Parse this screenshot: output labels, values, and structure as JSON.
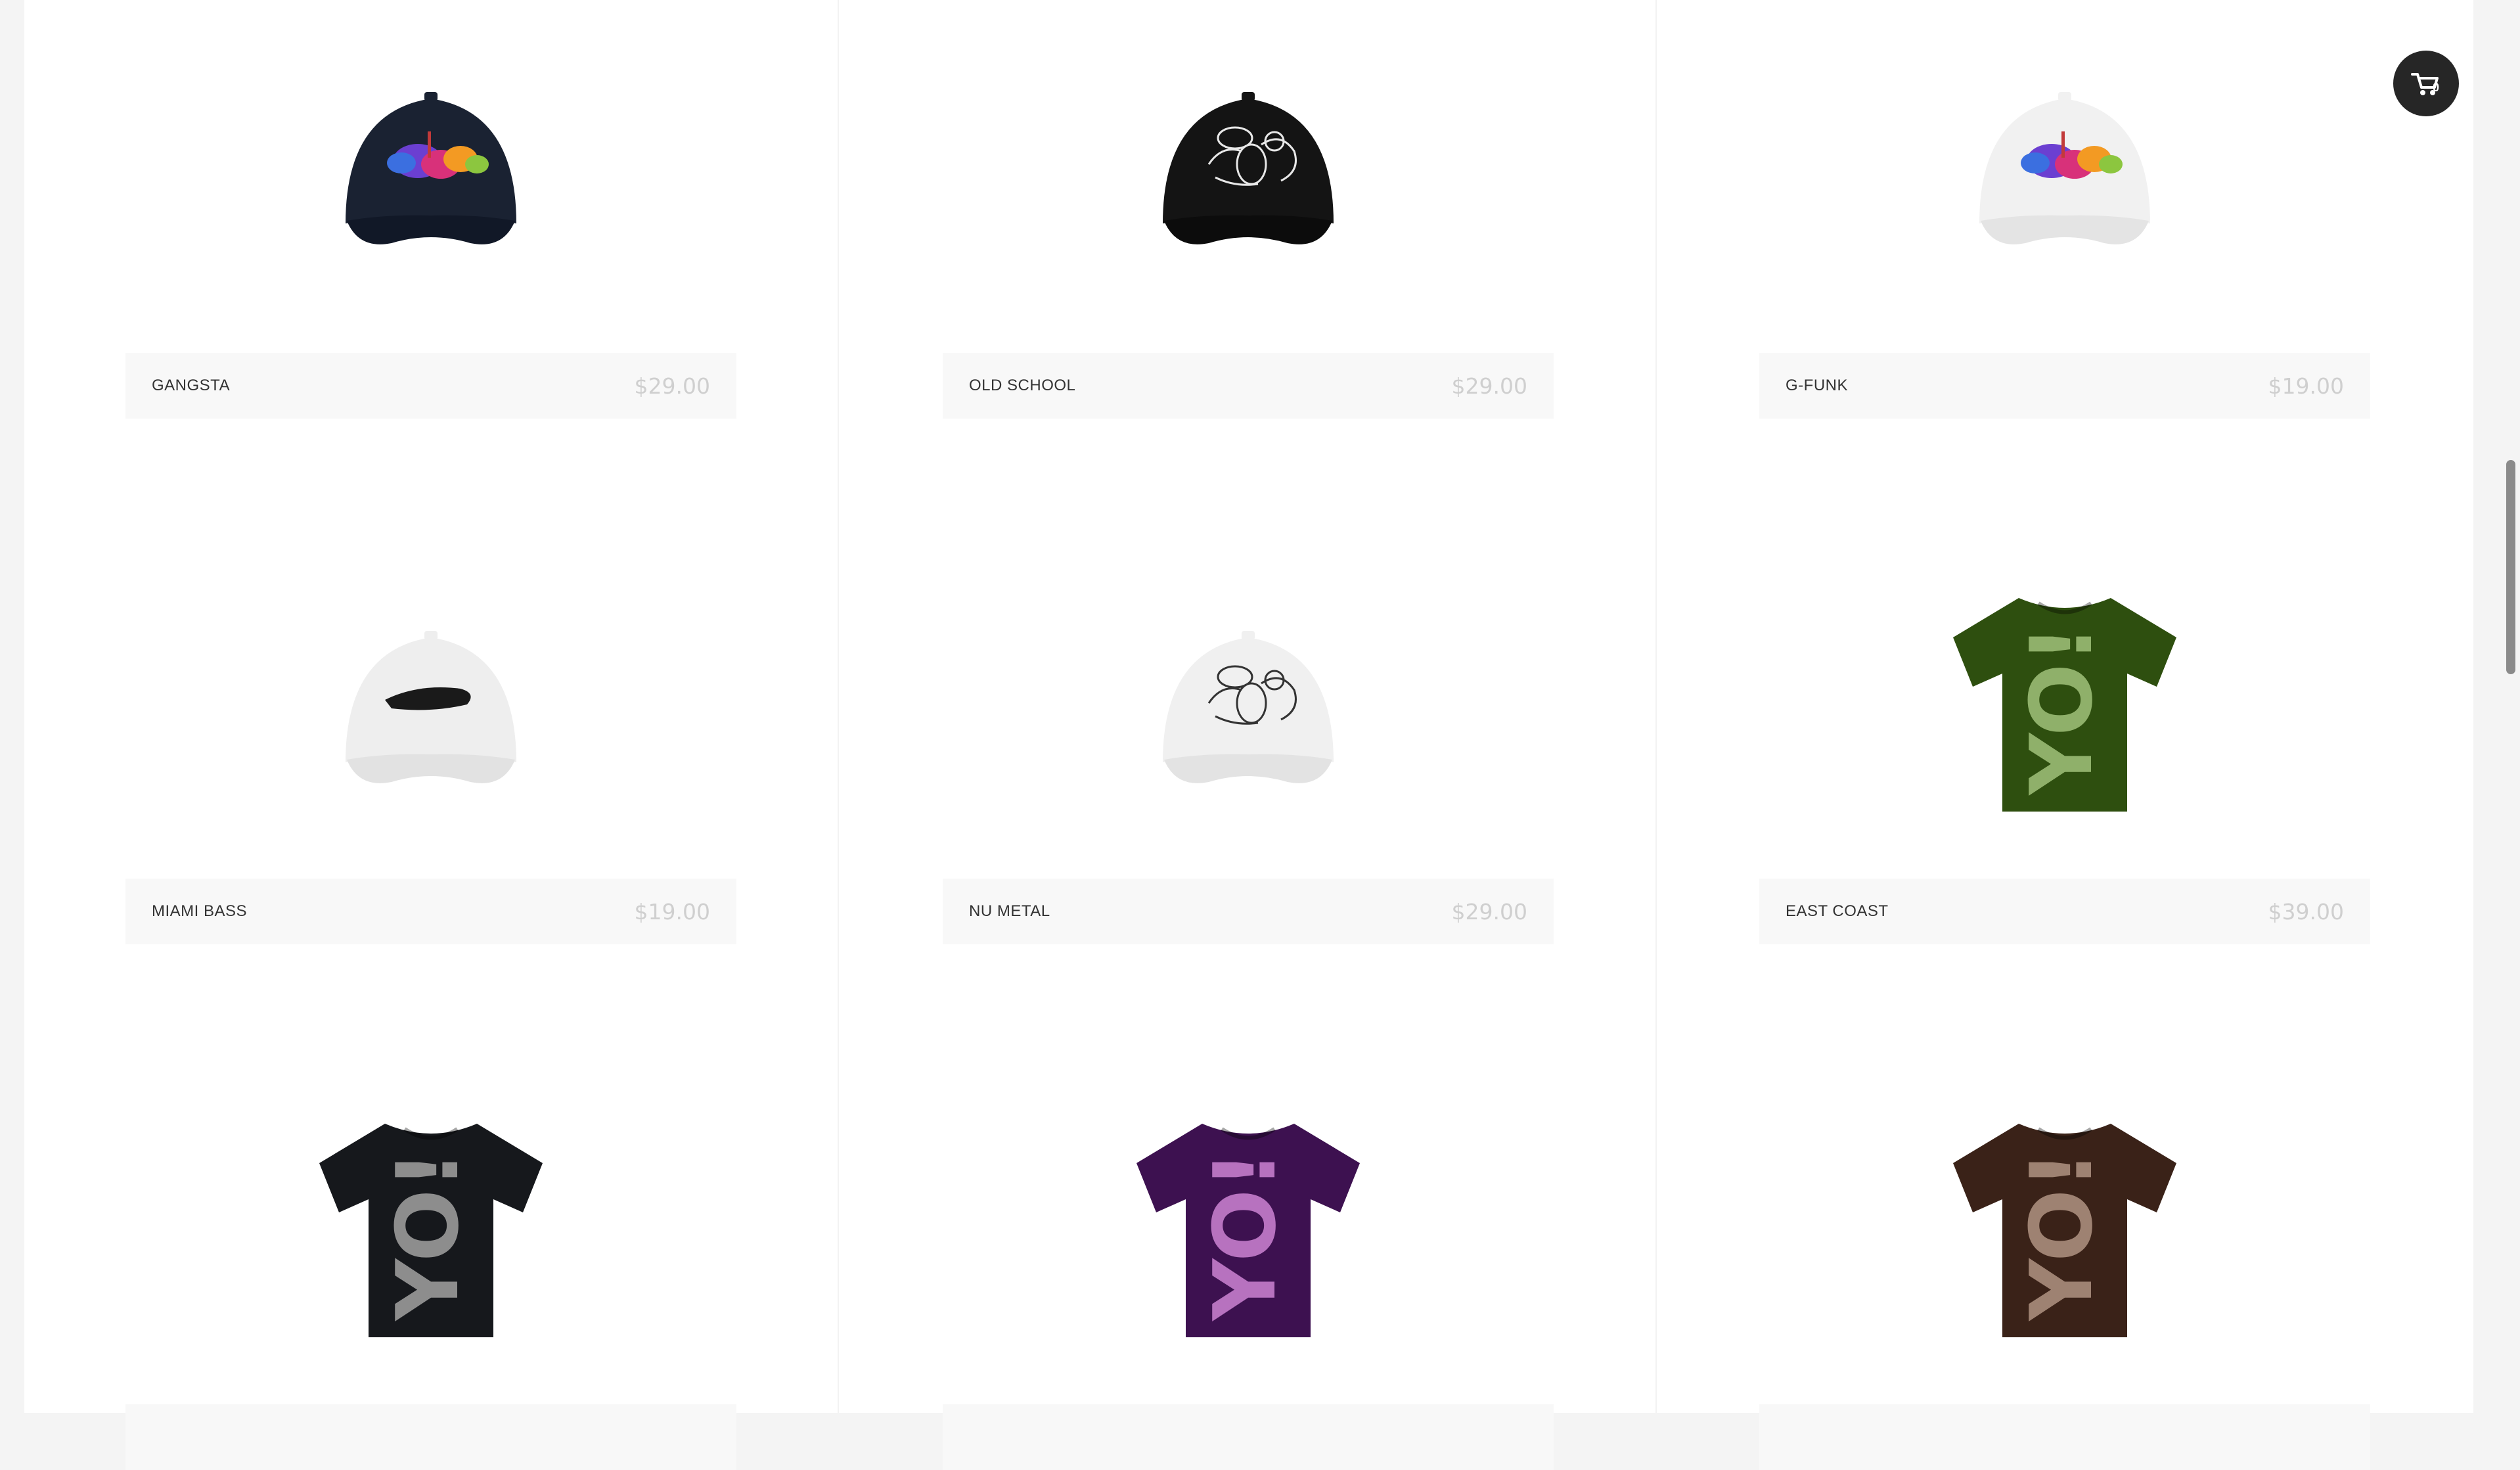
{
  "cart": {
    "count": "0",
    "icon": "cart-icon"
  },
  "products": [
    {
      "name": "GANGSTA",
      "price": "$29.00",
      "kind": "cap",
      "body": "#1a2232",
      "visor": "#111827",
      "art": "splash"
    },
    {
      "name": "OLD SCHOOL",
      "price": "$29.00",
      "kind": "cap",
      "body": "#141414",
      "visor": "#0c0c0c",
      "art": "graffiti-light"
    },
    {
      "name": "G-FUNK",
      "price": "$19.00",
      "kind": "cap",
      "body": "#f1f1f1",
      "visor": "#e4e4e4",
      "art": "splash"
    },
    {
      "name": "MIAMI BASS",
      "price": "$19.00",
      "kind": "cap",
      "body": "#eeeeee",
      "visor": "#e2e2e2",
      "art": "brush"
    },
    {
      "name": "NU METAL",
      "price": "$29.00",
      "kind": "cap",
      "body": "#f0f0f0",
      "visor": "#e3e3e3",
      "art": "graffiti-dark"
    },
    {
      "name": "EAST COAST",
      "price": "$39.00",
      "kind": "shirt",
      "body": "#2e4f0f",
      "text_color": "#8fb06a"
    },
    {
      "name": "",
      "price": "",
      "kind": "shirt",
      "body": "#16181c",
      "text_color": "#8d8d8d"
    },
    {
      "name": "",
      "price": "",
      "kind": "shirt",
      "body": "#3d1150",
      "text_color": "#b772bf"
    },
    {
      "name": "",
      "price": "",
      "kind": "shirt",
      "body": "#3a2218",
      "text_color": "#9e8272"
    }
  ]
}
